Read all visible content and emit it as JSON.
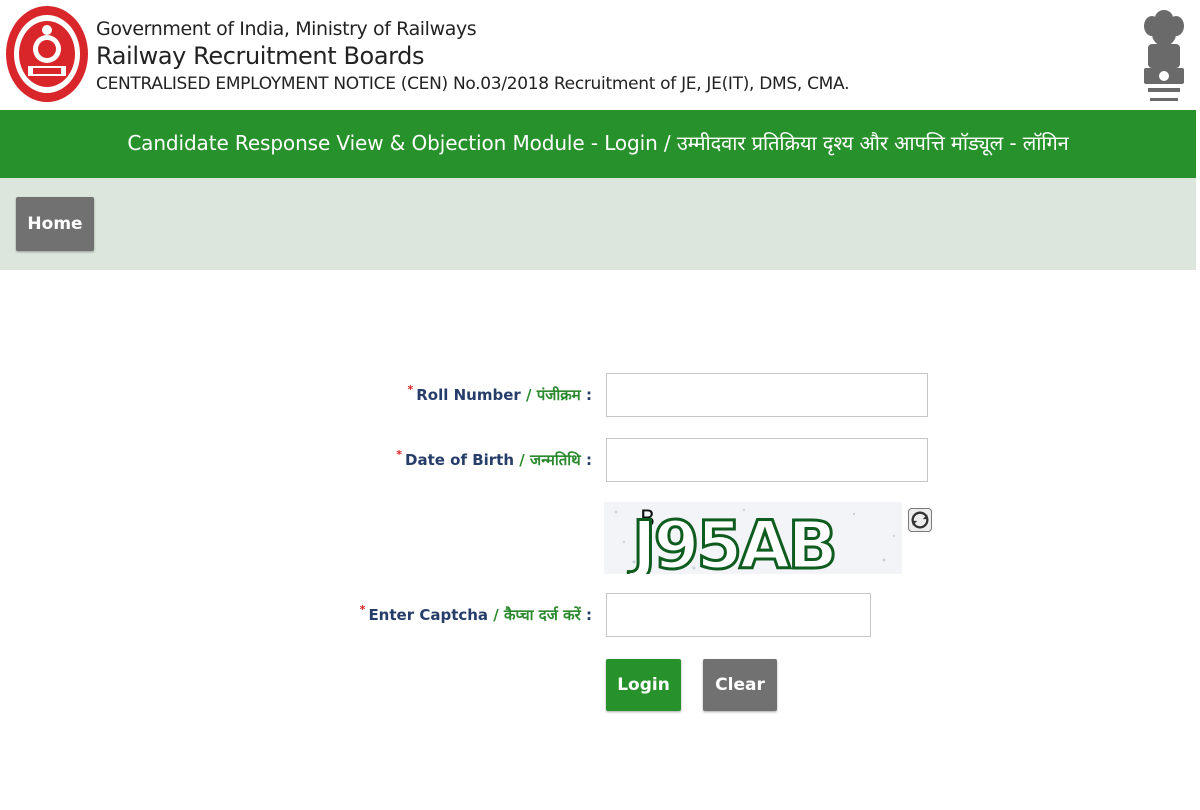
{
  "header": {
    "line1": "Government of India, Ministry of Railways",
    "line2": "Railway Recruitment Boards",
    "line3": "CENTRALISED EMPLOYMENT NOTICE (CEN) No.03/2018 Recruitment of JE, JE(IT), DMS, CMA.",
    "left_logo_icon": "indian-railways-logo-icon",
    "right_logo_icon": "national-emblem-icon"
  },
  "module_title": "Candidate Response View & Objection Module - Login / उम्मीदवार प्रतिक्रिया दृश्य और आपत्ति मॉड्यूल - लॉगिन",
  "nav": {
    "home_label": "Home"
  },
  "form": {
    "required_mark": "*",
    "separator": "/",
    "colon": ":",
    "roll_number": {
      "label_en": "Roll Number",
      "label_hi": "पंजीक्रम",
      "value": "",
      "placeholder": ""
    },
    "dob": {
      "label_en": "Date of Birth",
      "label_hi": "जन्मतिथि",
      "value": "",
      "placeholder": ""
    },
    "captcha": {
      "code": "J95AB",
      "noise": "B",
      "label_en": "Enter Captcha",
      "label_hi": "कैप्चा दर्ज करें",
      "value": "",
      "placeholder": "",
      "refresh_icon": "refresh-icon"
    },
    "login_label": "Login",
    "clear_label": "Clear"
  },
  "colors": {
    "green": "#27922b",
    "nav_bg": "#dde6dc",
    "button_gray": "#717171",
    "label_blue": "#263d6a",
    "label_green": "#2c8a2e",
    "required_red": "#d61f1f"
  }
}
